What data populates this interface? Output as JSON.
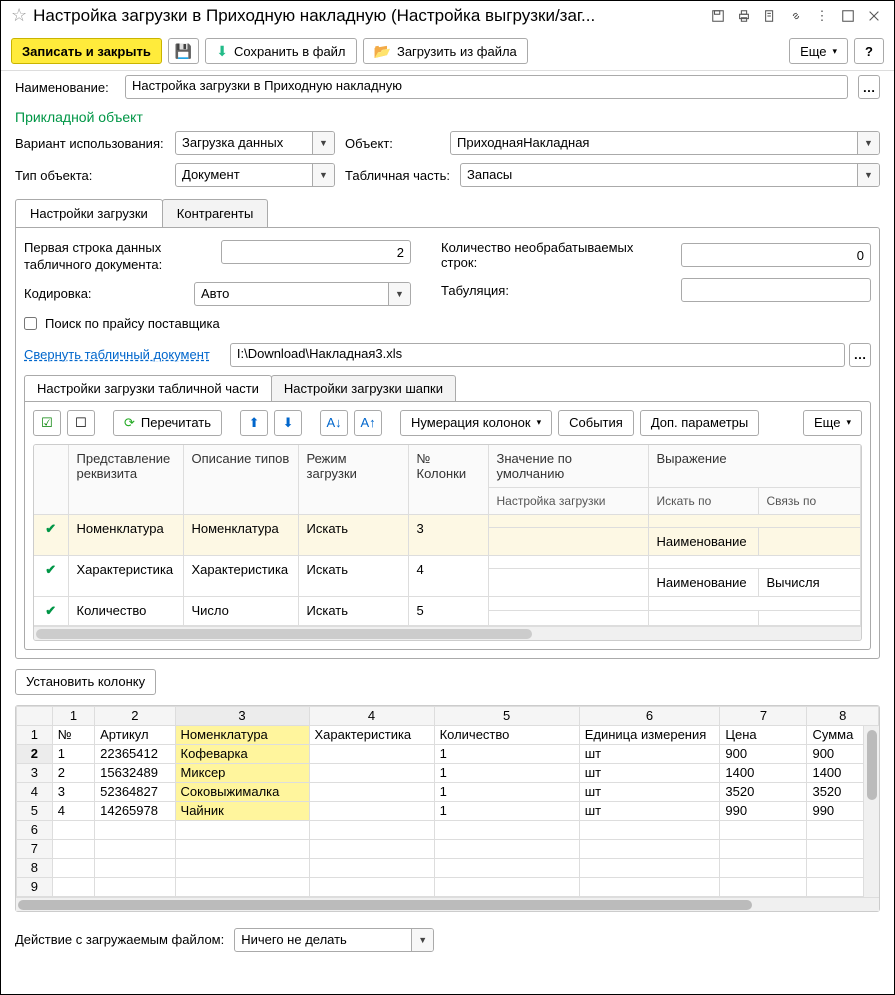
{
  "title": "Настройка загрузки в Приходную накладную (Настройка выгрузки/заг...",
  "toolbar": {
    "save_close": "Записать и закрыть",
    "save_file": "Сохранить в файл",
    "load_file": "Загрузить из файла",
    "more": "Еще",
    "help": "?"
  },
  "fields": {
    "name_label": "Наименование:",
    "name_value": "Настройка загрузки в Приходную накладную",
    "section": "Прикладной объект",
    "usage_label": "Вариант использования:",
    "usage_value": "Загрузка данных",
    "object_label": "Объект:",
    "object_value": "ПриходнаяНакладная",
    "type_label": "Тип объекта:",
    "type_value": "Документ",
    "table_part_label": "Табличная часть:",
    "table_part_value": "Запасы"
  },
  "tabs": {
    "t1": "Настройки загрузки",
    "t2": "Контрагенты"
  },
  "load": {
    "first_row_label": "Первая строка данных табличного документа:",
    "first_row_value": "2",
    "skip_rows_label": "Количество необрабатываемых строк:",
    "skip_rows_value": "0",
    "encoding_label": "Кодировка:",
    "encoding_value": "Авто",
    "tab_label": "Табуляция:",
    "tab_value": "",
    "search_price": "Поиск по прайсу поставщика",
    "collapse_link": "Свернуть табличный документ",
    "file_path": "I:\\Download\\Накладная3.xls"
  },
  "subtabs": {
    "s1": "Настройки загрузки табличной части",
    "s2": "Настройки загрузки шапки"
  },
  "gridbar": {
    "reread": "Перечитать",
    "numcols": "Нумерация колонок",
    "events": "События",
    "addparams": "Доп. параметры",
    "more": "Еще"
  },
  "grid": {
    "headers": {
      "h1": "Представление реквизита",
      "h2": "Описание типов",
      "h3": "Режим загрузки",
      "h4": "№ Колонки",
      "h5": "Значение по умолчанию",
      "h6": "Выражение",
      "sh1": "Настройка загрузки",
      "sh2": "Искать по",
      "sh3": "Связь по"
    },
    "rows": [
      {
        "p": "Номенклатура",
        "t": "Номенклатура",
        "m": "Искать",
        "n": "3",
        "s2": "Наименование",
        "s3": ""
      },
      {
        "p": "Характеристика",
        "t": "Характеристика",
        "m": "Искать",
        "n": "4",
        "s2": "Наименование",
        "s3": "Вычисля"
      },
      {
        "p": "Количество",
        "t": "Число",
        "m": "Искать",
        "n": "5",
        "s2": "",
        "s3": ""
      }
    ]
  },
  "set_col_btn": "Установить колонку",
  "sheet": {
    "cols": [
      "1",
      "2",
      "3",
      "4",
      "5",
      "6",
      "7",
      "8"
    ],
    "header": [
      "№",
      "Артикул",
      "Номенклатура",
      "Характеристика",
      "Количество",
      "Единица измерения",
      "Цена",
      "Сумма"
    ],
    "rows": [
      [
        "1",
        "22365412",
        "Кофеварка",
        "",
        "1",
        "шт",
        "900",
        "900"
      ],
      [
        "2",
        "15632489",
        "Миксер",
        "",
        "1",
        "шт",
        "1400",
        "1400"
      ],
      [
        "3",
        "52364827",
        "Соковыжималка",
        "",
        "1",
        "шт",
        "3520",
        "3520"
      ],
      [
        "4",
        "14265978",
        "Чайник",
        "",
        "1",
        "шт",
        "990",
        "990"
      ]
    ]
  },
  "bottom": {
    "label": "Действие с загружаемым файлом:",
    "value": "Ничего не делать"
  }
}
